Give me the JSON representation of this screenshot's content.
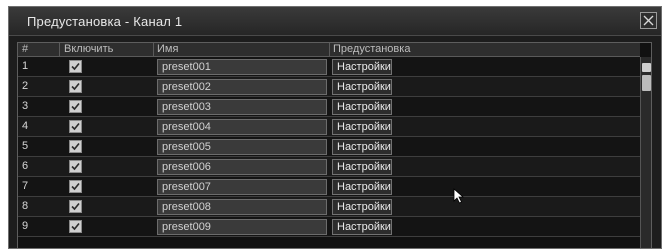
{
  "dialog": {
    "title": "Предустановка - Канал 1",
    "close_icon": "close-icon"
  },
  "table": {
    "headers": {
      "num": "#",
      "enable": "Включить",
      "name": "Имя",
      "preset": "Предустановка"
    },
    "rows": [
      {
        "num": "1",
        "enabled": true,
        "name": "preset001",
        "button": "Настройки"
      },
      {
        "num": "2",
        "enabled": true,
        "name": "preset002",
        "button": "Настройки"
      },
      {
        "num": "3",
        "enabled": true,
        "name": "preset003",
        "button": "Настройки"
      },
      {
        "num": "4",
        "enabled": true,
        "name": "preset004",
        "button": "Настройки"
      },
      {
        "num": "5",
        "enabled": true,
        "name": "preset005",
        "button": "Настройки"
      },
      {
        "num": "6",
        "enabled": true,
        "name": "preset006",
        "button": "Настройки"
      },
      {
        "num": "7",
        "enabled": true,
        "name": "preset007",
        "button": "Настройки"
      },
      {
        "num": "8",
        "enabled": true,
        "name": "preset008",
        "button": "Настройки"
      },
      {
        "num": "9",
        "enabled": true,
        "name": "preset009",
        "button": "Настройки"
      }
    ]
  },
  "colors": {
    "background": "#1d1d1d",
    "header": "#2e2e2e",
    "checkbox": "#cfcfcf"
  }
}
